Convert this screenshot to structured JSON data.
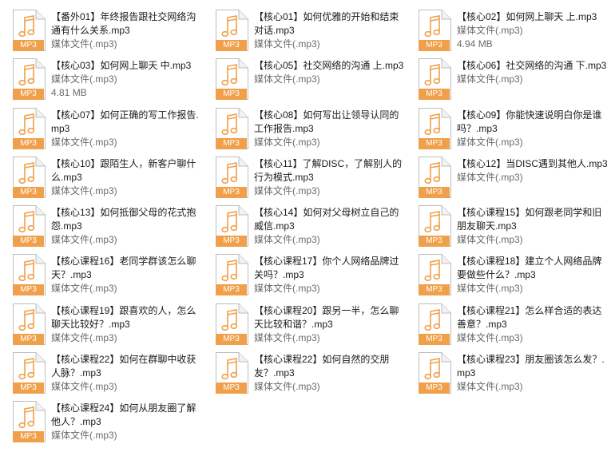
{
  "files": [
    {
      "name": "【番外01】年终报告跟社交网络沟通有什么关系.mp3",
      "type": "媒体文件(.mp3)",
      "size": ""
    },
    {
      "name": "【核心01】如何优雅的开始和结束对话.mp3",
      "type": "媒体文件(.mp3)",
      "size": ""
    },
    {
      "name": "【核心02】如何网上聊天 上.mp3",
      "type": "媒体文件(.mp3)",
      "size": "4.94 MB"
    },
    {
      "name": "【核心03】如何网上聊天 中.mp3",
      "type": "媒体文件(.mp3)",
      "size": "4.81 MB"
    },
    {
      "name": "【核心05】社交网络的沟通 上.mp3",
      "type": "媒体文件(.mp3)",
      "size": ""
    },
    {
      "name": "【核心06】社交网络的沟通 下.mp3",
      "type": "媒体文件(.mp3)",
      "size": ""
    },
    {
      "name": "【核心07】如何正确的写工作报告.mp3",
      "type": "媒体文件(.mp3)",
      "size": ""
    },
    {
      "name": "【核心08】如何写出让领导认同的工作报告.mp3",
      "type": "媒体文件(.mp3)",
      "size": ""
    },
    {
      "name": "【核心09】你能快速说明白你是谁吗？.mp3",
      "type": "媒体文件(.mp3)",
      "size": ""
    },
    {
      "name": "【核心10】跟陌生人，新客户聊什么.mp3",
      "type": "媒体文件(.mp3)",
      "size": ""
    },
    {
      "name": "【核心11】了解DISC，了解别人的行为模式.mp3",
      "type": "媒体文件(.mp3)",
      "size": ""
    },
    {
      "name": "【核心12】当DISC遇到其他人.mp3",
      "type": "媒体文件(.mp3)",
      "size": ""
    },
    {
      "name": "【核心13】如何抵御父母的花式抱怨.mp3",
      "type": "媒体文件(.mp3)",
      "size": ""
    },
    {
      "name": "【核心14】如何对父母树立自己的威信.mp3",
      "type": "媒体文件(.mp3)",
      "size": ""
    },
    {
      "name": "【核心课程15】如何跟老同学和旧朋友聊天.mp3",
      "type": "媒体文件(.mp3)",
      "size": ""
    },
    {
      "name": "【核心课程16】老同学群该怎么聊天？.mp3",
      "type": "媒体文件(.mp3)",
      "size": ""
    },
    {
      "name": "【核心课程17】你个人网络品牌过关吗？.mp3",
      "type": "媒体文件(.mp3)",
      "size": ""
    },
    {
      "name": "【核心课程18】建立个人网络品牌要做些什么？.mp3",
      "type": "媒体文件(.mp3)",
      "size": ""
    },
    {
      "name": "【核心课程19】跟喜欢的人，怎么聊天比较好？.mp3",
      "type": "媒体文件(.mp3)",
      "size": ""
    },
    {
      "name": "【核心课程20】跟另一半，怎么聊天比较和谐？.mp3",
      "type": "媒体文件(.mp3)",
      "size": ""
    },
    {
      "name": "【核心课程21】怎么样合适的表达善意？.mp3",
      "type": "媒体文件(.mp3)",
      "size": ""
    },
    {
      "name": "【核心课程22】如何在群聊中收获人脉？.mp3",
      "type": "媒体文件(.mp3)",
      "size": ""
    },
    {
      "name": "【核心课程22】如何自然的交朋友？.mp3",
      "type": "媒体文件(.mp3)",
      "size": ""
    },
    {
      "name": "【核心课程23】朋友圈该怎么发？.mp3",
      "type": "媒体文件(.mp3)",
      "size": ""
    },
    {
      "name": "【核心课程24】如何从朋友圈了解他人？.mp3",
      "type": "媒体文件(.mp3)",
      "size": ""
    }
  ],
  "icon": {
    "name": "mp3-file-icon",
    "label": "MP3",
    "accent": "#f0a04a",
    "body": "#ffffff",
    "border": "#b9b9b9"
  }
}
